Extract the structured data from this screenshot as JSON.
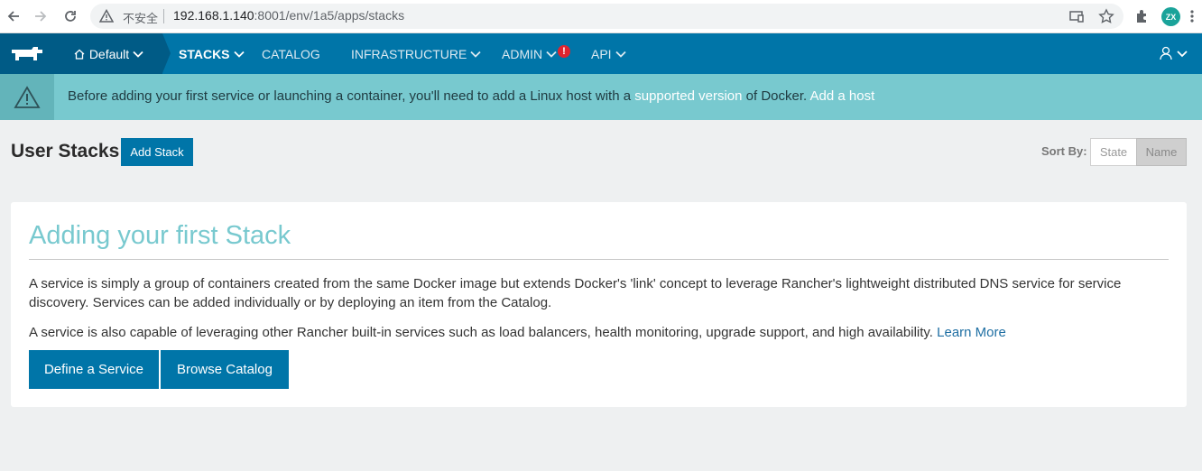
{
  "browser": {
    "insecure_label": "不安全",
    "url_host": "192.168.1.140",
    "url_rest": ":8001/env/1a5/apps/stacks",
    "profile_initials": "ZX"
  },
  "header": {
    "environment": "Default",
    "nav": {
      "stacks": "STACKS",
      "catalog": "CATALOG",
      "infrastructure": "INFRASTRUCTURE",
      "admin": "ADMIN",
      "api": "API"
    },
    "admin_alert": "!"
  },
  "banner": {
    "text_before": "Before adding your first service or launching a container, you'll need to add a Linux host with a",
    "supported_link": "supported version",
    "text_middle": "of Docker.",
    "add_host_link": "Add a host"
  },
  "page": {
    "title": "User Stacks",
    "add_stack": "Add Stack",
    "sort_by_label": "Sort By:",
    "sort_options": [
      "State",
      "Name"
    ],
    "sort_selected": "Name"
  },
  "card": {
    "title": "Adding your first Stack",
    "para1": "A service is simply a group of containers created from the same Docker image but extends Docker's 'link' concept to leverage Rancher's lightweight distributed DNS service for service discovery. Services can be added individually or by deploying an item from the Catalog.",
    "para2": "A service is also capable of leveraging other Rancher built-in services such as load balancers, health monitoring, upgrade support, and high availability.",
    "learn_more": "Learn More",
    "define_service": "Define a Service",
    "browse_catalog": "Browse Catalog"
  },
  "colors": {
    "header_blue": "#0075a8",
    "header_dark": "#005b86",
    "banner_teal": "#78c9cf",
    "alert_red": "#e0242f"
  }
}
